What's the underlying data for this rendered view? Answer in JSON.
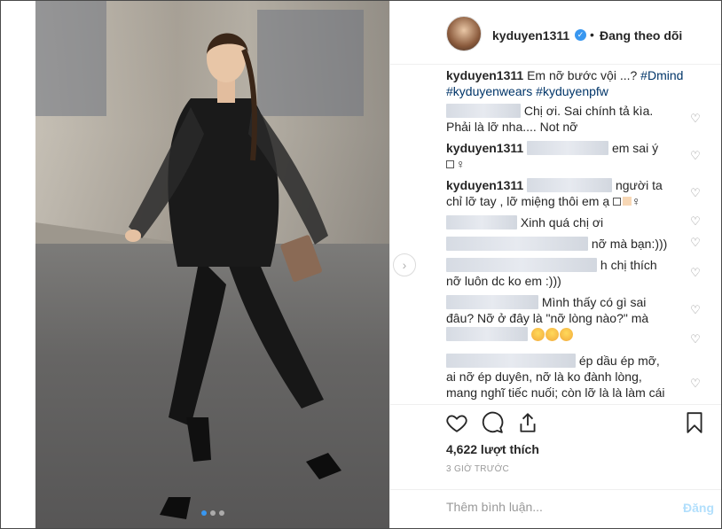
{
  "header": {
    "username": "kyduyen1311",
    "separator": "•",
    "follow_status": "Đang theo dõi"
  },
  "comments": [
    {
      "user": "kyduyen1311",
      "text": "Em nỡ bước vội ...?",
      "tags": [
        "#Dmind",
        "#kyduyenwears",
        "#kyduyenpfw"
      ]
    },
    {
      "text_a": "Chị ơi. Sai chính tả kìa.",
      "text_b": "Phải là lỡ nha.... Not nỡ"
    },
    {
      "user": "kyduyen1311",
      "text": "em sai ý"
    },
    {
      "user": "kyduyen1311",
      "text_a": "người ta",
      "text_b": "chỉ lỡ tay , lỡ miệng thôi em ạ"
    },
    {
      "text": "Xinh quá chị ơi"
    },
    {
      "text": "nỡ mà bạn:)))"
    },
    {
      "text_a": "h chị thích",
      "text_b": "nỡ luôn dc ko em :)))"
    },
    {
      "text_a": "Mình thấy có gì sai",
      "text_b": "đâu? Nỡ ở đây là \"nỡ lòng nào?\" mà"
    },
    {
      "text_a": "ép dầu ép mỡ,",
      "text_b": "ai nỡ ép duyên, nỡ là ko đành lòng,",
      "text_c": "mang nghĩ tiếc nuối; còn lỡ là là làm cái"
    }
  ],
  "likes": "4,622 lượt thích",
  "time": "3 GIỜ TRƯỚC",
  "comment_placeholder": "Thêm bình luận...",
  "post_label": "Đăng",
  "carousel": {
    "count": 3,
    "active_index": 0
  },
  "colors": {
    "link": "#003569",
    "verified": "#3897f0",
    "post_disabled": "#b2dffc"
  },
  "icons": [
    "heart-icon",
    "comment-icon",
    "share-icon",
    "bookmark-icon",
    "verified-icon",
    "chevron-right-icon"
  ]
}
